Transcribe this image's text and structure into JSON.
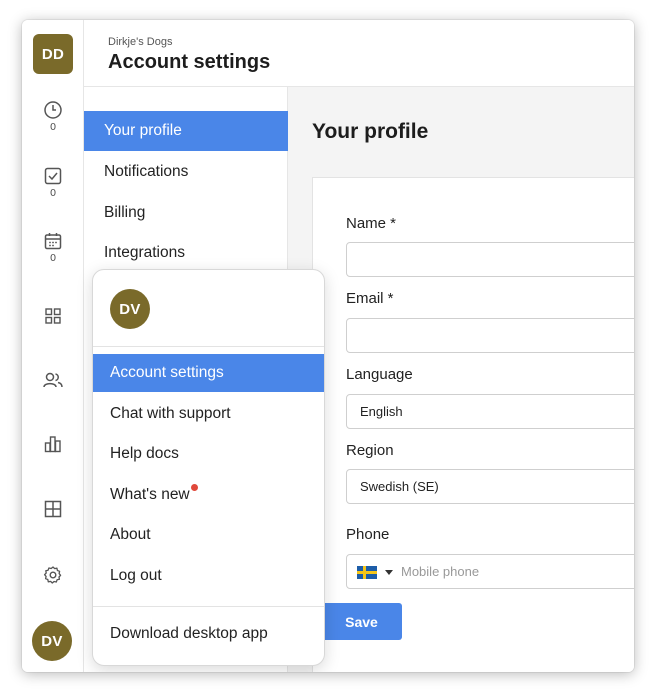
{
  "workspace": {
    "avatar_initials": "DD",
    "name": "Dirkje's Dogs"
  },
  "header": {
    "title": "Account settings"
  },
  "rail": {
    "items": [
      {
        "icon": "clock-icon",
        "count": "0"
      },
      {
        "icon": "checkbox-icon",
        "count": "0"
      },
      {
        "icon": "calendar-icon",
        "count": "0"
      },
      {
        "icon": "grid-icon"
      },
      {
        "icon": "people-icon"
      },
      {
        "icon": "bar-chart-icon"
      },
      {
        "icon": "layout-icon"
      },
      {
        "icon": "gear-icon"
      }
    ],
    "user_initials": "DV"
  },
  "settings_nav": {
    "items": [
      {
        "label": "Your profile",
        "active": true
      },
      {
        "label": "Notifications"
      },
      {
        "label": "Billing"
      },
      {
        "label": "Integrations"
      }
    ]
  },
  "profile": {
    "title": "Your profile",
    "fields": {
      "name": {
        "label": "Name *",
        "value": ""
      },
      "email": {
        "label": "Email *",
        "value": ""
      },
      "language": {
        "label": "Language",
        "value": "English"
      },
      "region": {
        "label": "Region",
        "value": "Swedish (SE)"
      },
      "phone": {
        "label": "Phone",
        "placeholder": "Mobile phone",
        "flag": "Sweden"
      }
    },
    "save_label": "Save"
  },
  "user_menu": {
    "avatar_initials": "DV",
    "items": [
      {
        "label": "Account settings",
        "active": true
      },
      {
        "label": "Chat with support"
      },
      {
        "label": "Help docs"
      },
      {
        "label": "What's new",
        "badge": "red-dot"
      },
      {
        "label": "About"
      },
      {
        "label": "Log out"
      }
    ],
    "footer_item": "Download desktop app"
  },
  "colors": {
    "accent": "#4a86e8",
    "avatar": "#7a6a2a",
    "notification_dot": "#e0483b"
  }
}
